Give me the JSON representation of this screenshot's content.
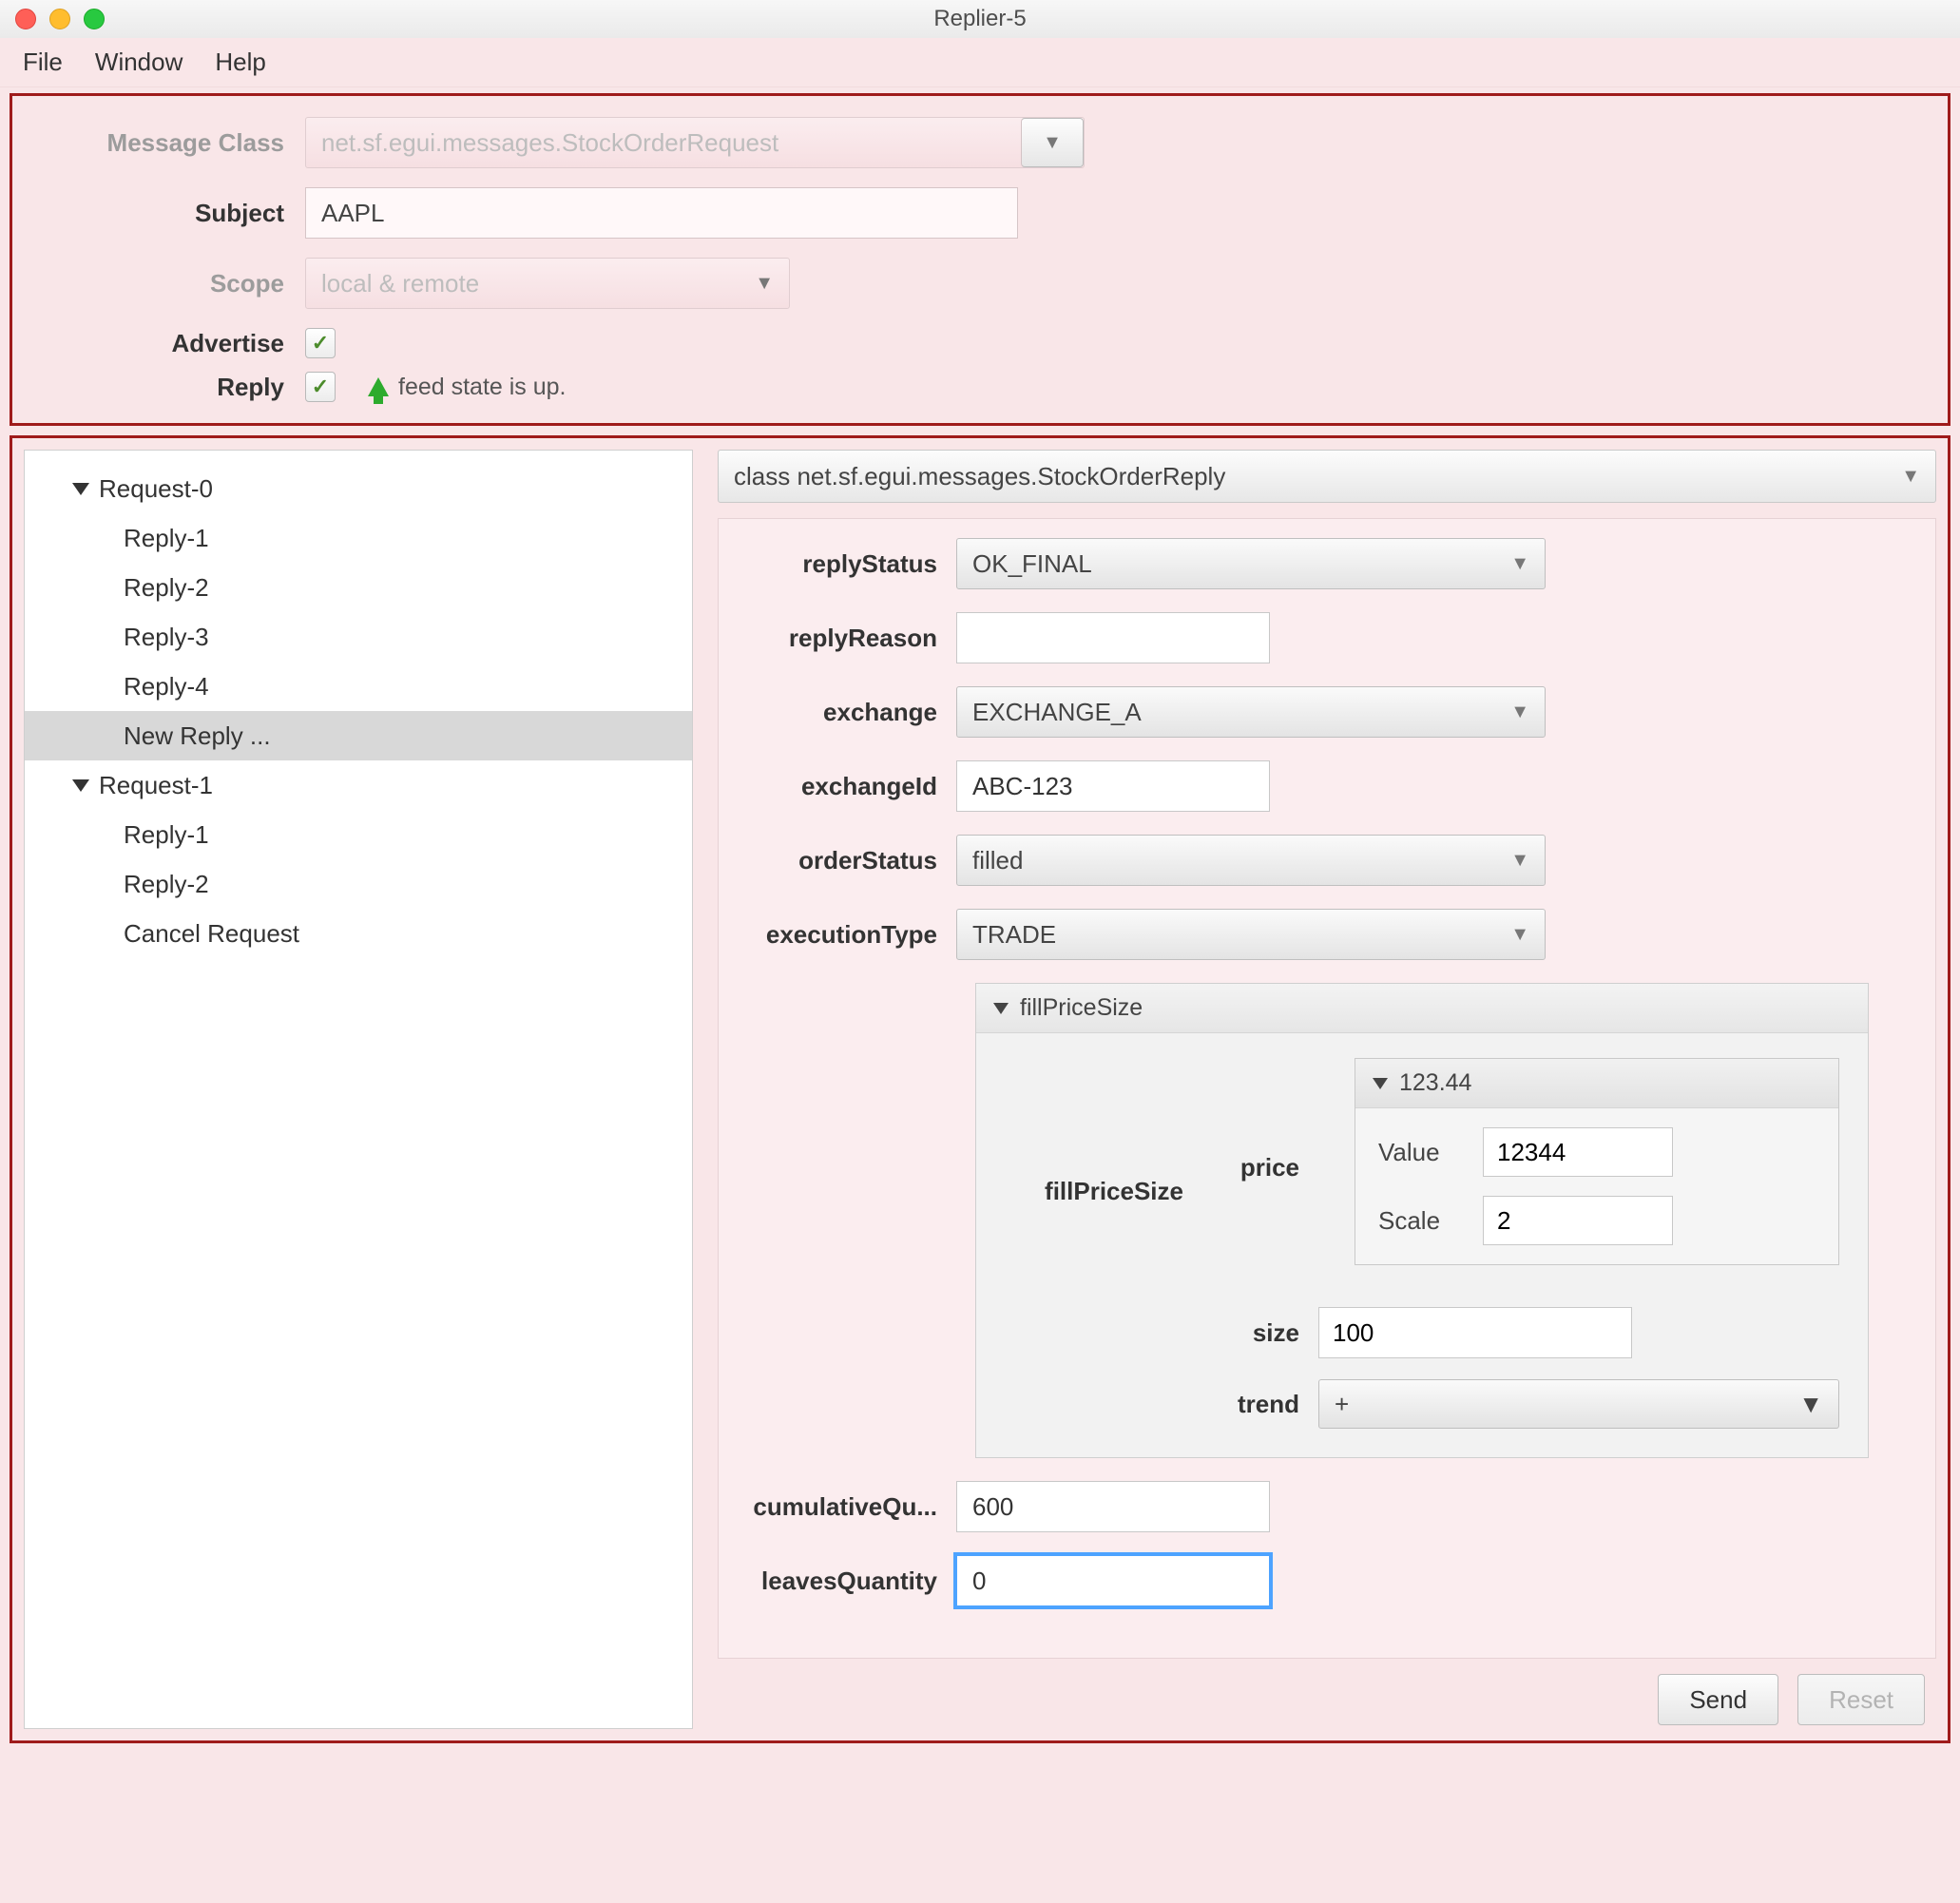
{
  "window": {
    "title": "Replier-5"
  },
  "menubar": {
    "file": "File",
    "window": "Window",
    "help": "Help"
  },
  "top": {
    "messageClassLabel": "Message Class",
    "messageClassValue": "net.sf.egui.messages.StockOrderRequest",
    "subjectLabel": "Subject",
    "subjectValue": "AAPL",
    "scopeLabel": "Scope",
    "scopeValue": "local & remote",
    "advertiseLabel": "Advertise",
    "advertiseChecked": true,
    "replyLabel": "Reply",
    "replyChecked": true,
    "feedState": "feed state is up."
  },
  "tree": {
    "items": [
      {
        "label": "Request-0",
        "level": 0,
        "expanded": true
      },
      {
        "label": "Reply-1",
        "level": 1
      },
      {
        "label": "Reply-2",
        "level": 1
      },
      {
        "label": "Reply-3",
        "level": 1
      },
      {
        "label": "Reply-4",
        "level": 1
      },
      {
        "label": "New Reply ...",
        "level": 1,
        "selected": true
      },
      {
        "label": "Request-1",
        "level": 0,
        "expanded": true
      },
      {
        "label": "Reply-1",
        "level": 1
      },
      {
        "label": "Reply-2",
        "level": 1
      },
      {
        "label": "Cancel Request",
        "level": 1
      }
    ]
  },
  "detail": {
    "classSelect": "class net.sf.egui.messages.StockOrderReply",
    "replyStatusLabel": "replyStatus",
    "replyStatusValue": "OK_FINAL",
    "replyReasonLabel": "replyReason",
    "replyReasonValue": "",
    "exchangeLabel": "exchange",
    "exchangeValue": "EXCHANGE_A",
    "exchangeIdLabel": "exchangeId",
    "exchangeIdValue": "ABC-123",
    "orderStatusLabel": "orderStatus",
    "orderStatusValue": "filled",
    "executionTypeLabel": "executionType",
    "executionTypeValue": "TRADE",
    "fillPriceSizeHeader": "fillPriceSize",
    "fillPriceSizeLabel": "fillPriceSize",
    "priceLabel": "price",
    "priceHeader": "123.44",
    "priceValueLabel": "Value",
    "priceValue": "12344",
    "priceScaleLabel": "Scale",
    "priceScale": "2",
    "sizeLabel": "size",
    "sizeValue": "100",
    "trendLabel": "trend",
    "trendValue": "+",
    "cumulativeLabel": "cumulativeQu...",
    "cumulativeValue": "600",
    "leavesLabel": "leavesQuantity",
    "leavesValue": "0"
  },
  "footer": {
    "send": "Send",
    "reset": "Reset"
  }
}
